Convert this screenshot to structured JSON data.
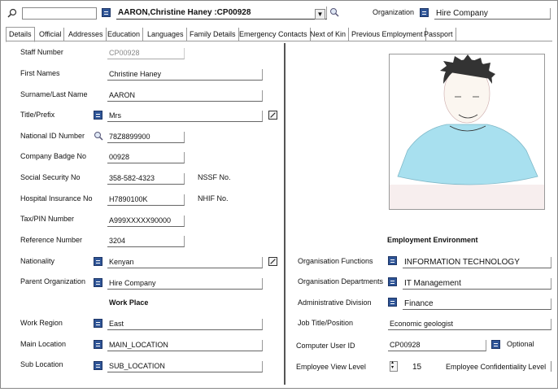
{
  "header": {
    "search_value": "",
    "employee_selected": "AARON,Christine Haney :CP00928",
    "organization_label": "Organization",
    "organization_value": "Hire Company"
  },
  "tabs": [
    "Details",
    "Official",
    "Addresses",
    "Education",
    "Languages",
    "Family Details",
    "Emergency Contacts",
    "Next of Kin",
    "Previous Employment",
    "Passport"
  ],
  "left": {
    "staff_number_label": "Staff Number",
    "staff_number": "CP00928",
    "first_names_label": "First Names",
    "first_names": "Christine Haney",
    "surname_label": "Surname/Last Name",
    "surname": "AARON",
    "title_label": "Title/Prefix",
    "title": "Mrs",
    "national_id_label": "National ID Number",
    "national_id": "78Z8899900",
    "badge_label": "Company Badge No",
    "badge": "00928",
    "ssn_label": "Social Security No",
    "ssn": "358-582-4323",
    "nssf_label": "NSSF No.",
    "hospital_label": "Hospital Insurance No",
    "hospital": "H7890100K",
    "nhif_label": "NHIF No.",
    "tax_label": "Tax/PIN Number",
    "tax": "A999XXXXX90000",
    "reference_label": "Reference Number",
    "reference": "3204",
    "nationality_label": "Nationality",
    "nationality": "Kenyan",
    "parent_org_label": "Parent Organization",
    "parent_org": "Hire Company",
    "work_place_heading": "Work Place",
    "work_region_label": "Work Region",
    "work_region": "East",
    "main_location_label": "Main Location",
    "main_location": "MAIN_LOCATION",
    "sub_location_label": "Sub Location",
    "sub_location": "SUB_LOCATION"
  },
  "right": {
    "employment_heading": "Employment Environment",
    "org_functions_label": "Organisation Functions",
    "org_functions": "INFORMATION TECHNOLOGY",
    "org_departments_label": "Organisation Departments",
    "org_departments": "IT Management",
    "admin_division_label": "Administrative Division",
    "admin_division": "Finance",
    "job_title_label": "Job Title/Position",
    "job_title": "Economic geologist",
    "computer_user_label": "Computer User ID",
    "computer_user": "CP00928",
    "optional_label": "Optional",
    "view_level_label": "Employee View Level",
    "view_level": "15",
    "confidentiality_label": "Employee Confidentiality Level"
  },
  "colors": {
    "accent": "#2f5597",
    "divider": "#555555"
  }
}
